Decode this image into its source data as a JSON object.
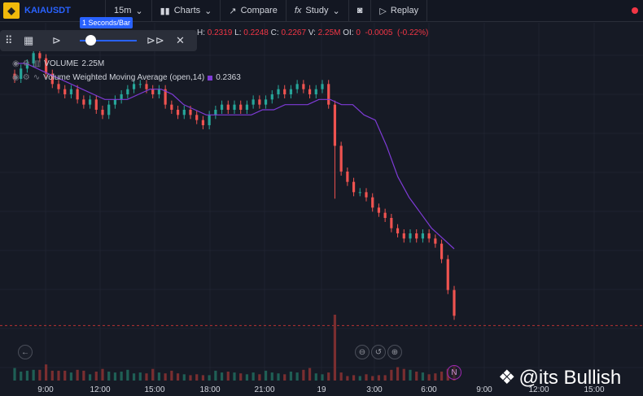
{
  "topbar": {
    "symbol": "KAIAUSDT",
    "interval": "15m",
    "charts": "Charts",
    "compare": "Compare",
    "study": "Study",
    "replay": "Replay"
  },
  "ohlc": {
    "h_label": "H:",
    "h": "0.2319",
    "l_label": "L:",
    "l": "0.2248",
    "c_label": "C:",
    "c": "0.2267",
    "v_label": "V:",
    "v": "2.25M",
    "oi_label": "OI:",
    "oi": "0",
    "change": "-0.0005",
    "change_pct": "(-0.22%)"
  },
  "indicators": [
    {
      "name": "VOLUME",
      "value": "2.25M"
    },
    {
      "name": "Volume Weighted Moving Average (open,14)",
      "value": "0.2363"
    }
  ],
  "replay": {
    "speed": "1 Seconds/Bar"
  },
  "colors": {
    "up": "#26a69a",
    "down": "#ef5350",
    "vwma": "#7e3bd6",
    "accent": "#2962ff"
  },
  "watermark": "@its Bullish",
  "chart_data": {
    "type": "candlestick",
    "xlabels": [
      "9:00",
      "12:00",
      "15:00",
      "18:00",
      "21:00",
      "19",
      "3:00",
      "6:00",
      "9:00",
      "12:00",
      "15:00"
    ],
    "ylim": [
      0.2262,
      0.2322
    ],
    "current_price": 0.2267,
    "closes": [
      0.2313,
      0.2315,
      0.2316,
      0.2318,
      0.2317,
      0.2314,
      0.2312,
      0.2311,
      0.231,
      0.2311,
      0.2309,
      0.2308,
      0.2309,
      0.2307,
      0.2306,
      0.2308,
      0.2309,
      0.231,
      0.2311,
      0.2312,
      0.2312,
      0.2311,
      0.231,
      0.2311,
      0.2308,
      0.2307,
      0.2306,
      0.2307,
      0.2306,
      0.2305,
      0.2304,
      0.2306,
      0.2307,
      0.2308,
      0.2307,
      0.2308,
      0.2307,
      0.2308,
      0.2309,
      0.2308,
      0.2309,
      0.231,
      0.2311,
      0.231,
      0.2311,
      0.2312,
      0.2311,
      0.231,
      0.2311,
      0.2312,
      0.2308,
      0.23,
      0.2295,
      0.2293,
      0.2291,
      0.2291,
      0.229,
      0.2288,
      0.2287,
      0.2286,
      0.2284,
      0.2283,
      0.2282,
      0.2283,
      0.2282,
      0.2283,
      0.2282,
      0.2281,
      0.2278,
      0.2272,
      0.2267
    ],
    "vwma": [
      0.2316,
      0.2316,
      0.2315,
      0.2314,
      0.2313,
      0.2312,
      0.2311,
      0.231,
      0.2309,
      0.2309,
      0.2309,
      0.231,
      0.2311,
      0.2311,
      0.231,
      0.2308,
      0.2307,
      0.2306,
      0.2306,
      0.2306,
      0.2306,
      0.2306,
      0.2307,
      0.2307,
      0.2308,
      0.2308,
      0.2308,
      0.2309,
      0.2309,
      0.2308,
      0.2308,
      0.2306,
      0.2305,
      0.23,
      0.2294,
      0.229,
      0.2287,
      0.2284,
      0.2282,
      0.228
    ],
    "volumes": [
      14,
      10,
      11,
      12,
      12,
      18,
      11,
      11,
      11,
      9,
      12,
      11,
      7,
      10,
      13,
      10,
      9,
      10,
      12,
      8,
      9,
      8,
      13,
      9,
      8,
      11,
      8,
      7,
      6,
      7,
      6,
      6,
      11,
      9,
      10,
      9,
      8,
      7,
      9,
      7,
      11,
      9,
      8,
      7,
      10,
      9,
      12,
      14,
      8,
      7,
      9,
      10,
      9,
      5,
      6,
      5,
      7,
      5,
      6,
      6,
      12,
      15,
      13,
      12,
      10,
      9,
      7,
      8,
      10,
      13,
      17
    ]
  }
}
